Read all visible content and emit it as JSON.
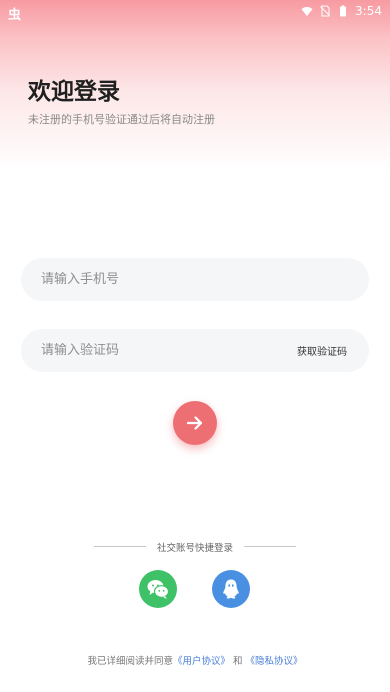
{
  "status_bar": {
    "app_icon": "虫",
    "time": "3:54",
    "icons": [
      "wifi-icon",
      "sim-off-icon",
      "battery-icon"
    ]
  },
  "header": {
    "title": "欢迎登录",
    "subtitle": "未注册的手机号验证通过后将自动注册"
  },
  "form": {
    "phone_placeholder": "请输入手机号",
    "code_placeholder": "请输入验证码",
    "get_code_label": "获取验证码",
    "submit_icon": "arrow-right-icon"
  },
  "social": {
    "label": "社交账号快捷登录",
    "providers": [
      "wechat-icon",
      "qq-icon"
    ]
  },
  "agreement": {
    "prefix": "我已详细阅读并同意",
    "user_agreement": "《用户协议》",
    "joiner": "和",
    "privacy_policy": "《隐私协议》"
  },
  "colors": {
    "accent": "#ee6f73",
    "wechat": "#3fc167",
    "qq": "#4a90e2",
    "link": "#4a7fd6"
  }
}
